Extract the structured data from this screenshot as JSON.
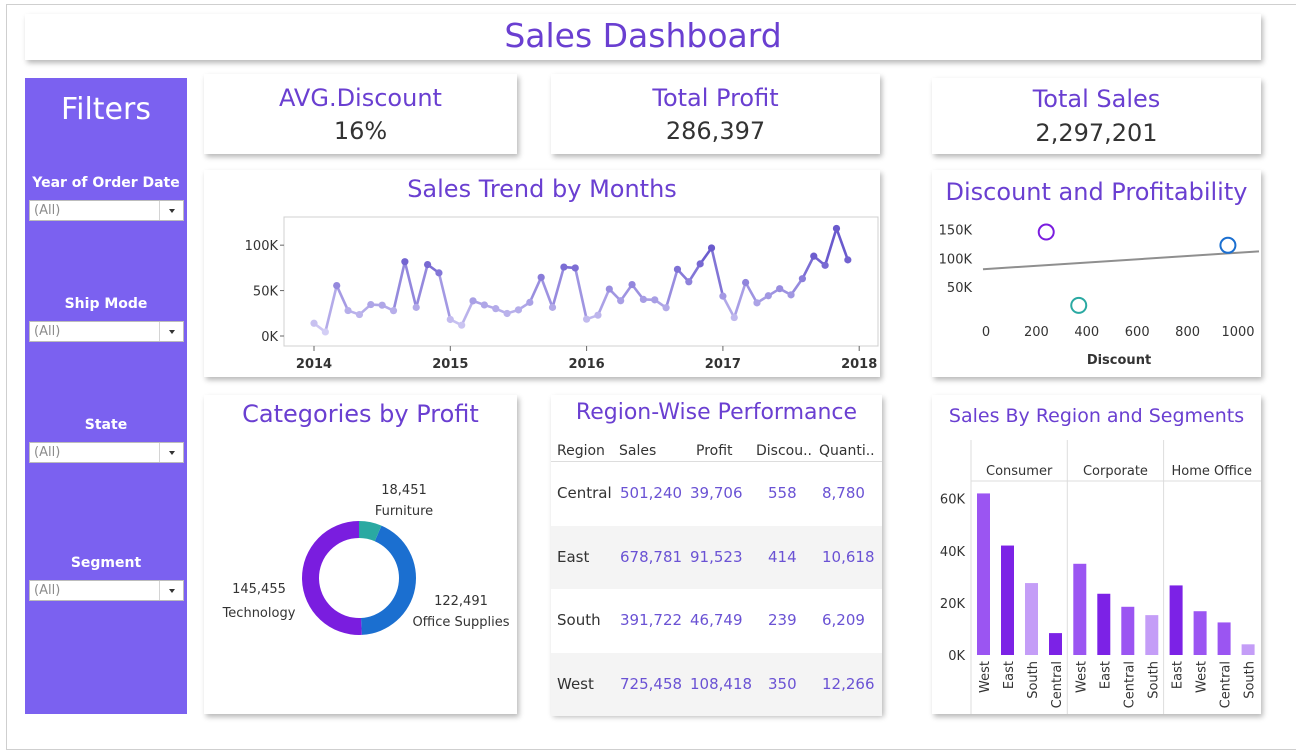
{
  "header": {
    "title": "Sales Dashboard"
  },
  "filters": {
    "title": "Filters",
    "items": [
      {
        "label": "Year of Order Date",
        "value": "(All)"
      },
      {
        "label": "Ship Mode",
        "value": "(All)"
      },
      {
        "label": "State",
        "value": "(All)"
      },
      {
        "label": "Segment",
        "value": "(All)"
      }
    ]
  },
  "kpis": {
    "avg_discount": {
      "label": "AVG.Discount",
      "value": "16%"
    },
    "total_profit": {
      "label": "Total Profit",
      "value": "286,397"
    },
    "total_sales": {
      "label": "Total Sales",
      "value": "2,297,201"
    }
  },
  "colors": {
    "accent": "#6a3fd1",
    "sidebar": "#7b61f0",
    "line_dark": "#6a5acd",
    "line_light": "#d9d4f7",
    "donut_technology": "#7a1ddf",
    "donut_office": "#1b6fd0",
    "donut_furniture": "#2aa9a2",
    "bar_dark": "#7c22e6",
    "bar_mid": "#9b55f2",
    "bar_light": "#c49df7"
  },
  "chart_data": [
    {
      "type": "line",
      "title": "Sales Trend by Months",
      "x_ticks": [
        "2014",
        "2015",
        "2016",
        "2017",
        "2018"
      ],
      "y_ticks": [
        "0K",
        "50K",
        "100K"
      ],
      "ylim": [
        0,
        120000
      ],
      "x_start": "2014-01",
      "values": [
        14000,
        4500,
        55500,
        28000,
        23600,
        34600,
        33900,
        27900,
        81800,
        31500,
        78600,
        69500,
        18200,
        11900,
        38700,
        34200,
        30100,
        24800,
        28800,
        37000,
        64600,
        31500,
        75900,
        74900,
        18500,
        22900,
        51700,
        38800,
        56600,
        40300,
        39800,
        31100,
        73400,
        59700,
        79400,
        96900,
        43900,
        20300,
        58900,
        36500,
        44300,
        52100,
        45300,
        63100,
        87900,
        77800,
        118400,
        83800
      ]
    },
    {
      "type": "scatter",
      "title": "Discount and Profitability",
      "xlabel": "Discount",
      "x_ticks": [
        "0",
        "200",
        "400",
        "600",
        "800",
        "1000"
      ],
      "y_ticks": [
        "50K",
        "100K",
        "150K"
      ],
      "xlim": [
        0,
        1080
      ],
      "ylim": [
        0,
        175000
      ],
      "points": [
        {
          "x": 239,
          "y": 145455,
          "color": "#7a1ddf"
        },
        {
          "x": 368,
          "y": 18451,
          "color": "#2aa9a2"
        },
        {
          "x": 960,
          "y": 122491,
          "color": "#1b6fd0"
        }
      ],
      "trendline": [
        [
          0,
          81000
        ],
        [
          1080,
          112000
        ]
      ]
    },
    {
      "type": "pie",
      "title": "Categories by Profit",
      "slices": [
        {
          "name": "Technology",
          "value": 145455,
          "label": "145,455"
        },
        {
          "name": "Office Supplies",
          "value": 122491,
          "label": "122,491"
        },
        {
          "name": "Furniture",
          "value": 18451,
          "label": "18,451"
        }
      ]
    },
    {
      "type": "table",
      "title": "Region-Wise Performance",
      "columns": [
        "Region",
        "Sales",
        "Profit",
        "Discou..",
        "Quanti.."
      ],
      "rows": [
        [
          "Central",
          "501,240",
          "39,706",
          "558",
          "8,780"
        ],
        [
          "East",
          "678,781",
          "91,523",
          "414",
          "10,618"
        ],
        [
          "South",
          "391,722",
          "46,749",
          "239",
          "6,209"
        ],
        [
          "West",
          "725,458",
          "108,418",
          "350",
          "12,266"
        ]
      ]
    },
    {
      "type": "bar",
      "title": "Sales By Region and Segments",
      "y_ticks": [
        "0K",
        "20K",
        "40K",
        "60K"
      ],
      "ylim": [
        0,
        66000
      ],
      "groups": [
        {
          "name": "Consumer",
          "categories": [
            "West",
            "East",
            "South",
            "Central"
          ],
          "values": [
            62000,
            42000,
            27600,
            8400
          ]
        },
        {
          "name": "Corporate",
          "categories": [
            "West",
            "East",
            "Central",
            "South"
          ],
          "values": [
            35000,
            23500,
            18500,
            15300
          ]
        },
        {
          "name": "Home Office",
          "categories": [
            "East",
            "West",
            "Central",
            "South"
          ],
          "values": [
            26700,
            16800,
            12500,
            4100
          ]
        }
      ]
    }
  ]
}
